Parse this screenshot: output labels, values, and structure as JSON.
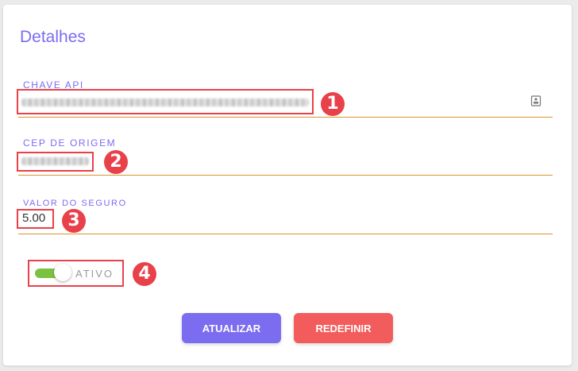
{
  "card": {
    "title": "Detalhes"
  },
  "fields": {
    "api_key": {
      "label": "CHAVE API",
      "value_obscured": true,
      "annotation": "1"
    },
    "origin_zip": {
      "label": "CEP DE ORIGEM",
      "value_obscured": true,
      "annotation": "2"
    },
    "insurance_value": {
      "label": "VALOR DO SEGURO",
      "value": "5.00",
      "annotation": "3"
    }
  },
  "toggle": {
    "label": "ATIVO",
    "state": "on",
    "annotation": "4"
  },
  "buttons": {
    "update_label": "ATUALIZAR",
    "reset_label": "REDEFINIR"
  },
  "colors": {
    "accent": "#7b6cf0",
    "danger": "#f25c5c",
    "annotation": "#e8414a",
    "field_line": "#d8942e",
    "toggle_on": "#7cc242"
  },
  "icons": {
    "api_key_action": "reveal-icon"
  }
}
